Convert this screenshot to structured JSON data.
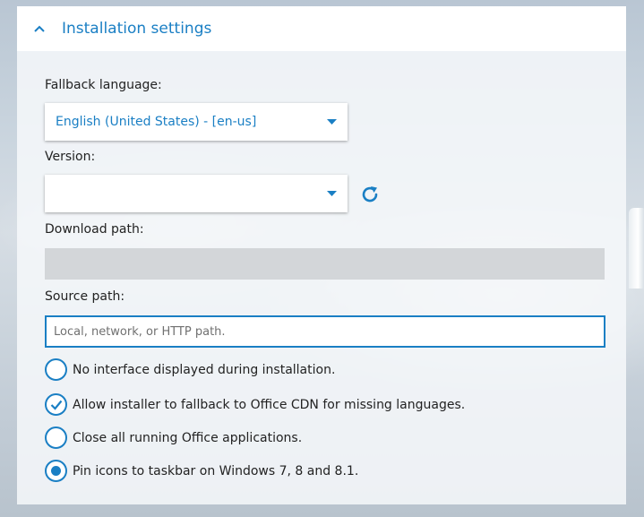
{
  "section": {
    "title": "Installation settings",
    "collapse_icon": "chevron-up-icon"
  },
  "fallback_language": {
    "label": "Fallback language:",
    "value": "English (United States) - [en-us]"
  },
  "version": {
    "label": "Version:",
    "value": "",
    "refresh_icon": "refresh-icon"
  },
  "download_path": {
    "label": "Download path:",
    "value": ""
  },
  "source_path": {
    "label": "Source path:",
    "placeholder": "Local, network, or HTTP path."
  },
  "options": [
    {
      "label": "No interface displayed during installation.",
      "state": "unchecked",
      "icon": "radio-empty-icon"
    },
    {
      "label": "Allow installer to fallback to Office CDN for missing languages.",
      "state": "checked",
      "icon": "checkmark-icon"
    },
    {
      "label": "Close all running Office applications.",
      "state": "unchecked",
      "icon": "radio-empty-icon"
    },
    {
      "label": "Pin icons to taskbar on Windows 7, 8 and 8.1.",
      "state": "selected",
      "icon": "radio-filled-icon"
    }
  ],
  "colors": {
    "accent": "#1a7fc4",
    "disabled_field": "#d3d6d9"
  }
}
